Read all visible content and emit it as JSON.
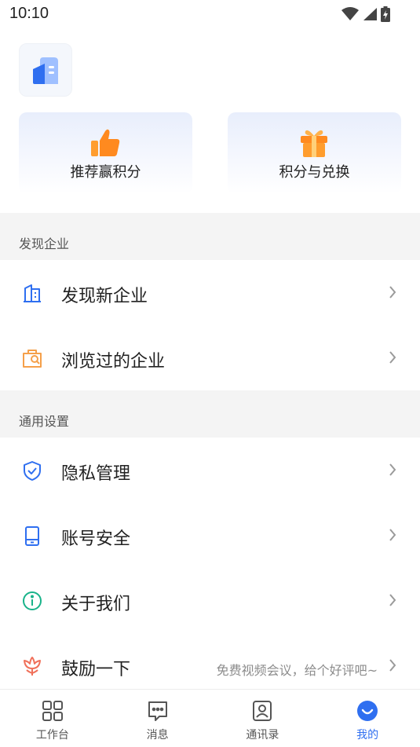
{
  "status_bar": {
    "time": "10:10",
    "icons": [
      "wifi-icon",
      "cellular-icon",
      "battery-charging-icon"
    ]
  },
  "logo": {
    "icon": "building-logo-icon",
    "colors": [
      "#2f6ff0",
      "#9fc0ff"
    ]
  },
  "promo": [
    {
      "label": "推荐赢积分",
      "icon": "thumbs-up-icon",
      "color": "#ff8a1f"
    },
    {
      "label": "积分与兑换",
      "icon": "gift-icon",
      "color": "#ff8a1f"
    }
  ],
  "sections": [
    {
      "title": "发现企业",
      "items": [
        {
          "label": "发现新企业",
          "icon": "building-icon",
          "icon_color": "#2f6ff0"
        },
        {
          "label": "浏览过的企业",
          "icon": "company-search-icon",
          "icon_color": "#f5a04a"
        }
      ]
    },
    {
      "title": "通用设置",
      "items": [
        {
          "label": "隐私管理",
          "icon": "shield-check-icon",
          "icon_color": "#2f6ff0"
        },
        {
          "label": "账号安全",
          "icon": "phone-icon",
          "icon_color": "#2f6ff0"
        },
        {
          "label": "关于我们",
          "icon": "info-icon",
          "icon_color": "#19b38a"
        },
        {
          "label": "鼓励一下",
          "icon": "flower-icon",
          "icon_color": "#f0705a",
          "hint": "免费视频会议，给个好评吧~"
        }
      ]
    }
  ],
  "tabs": [
    {
      "label": "工作台",
      "icon": "grid-icon",
      "active": false
    },
    {
      "label": "消息",
      "icon": "message-icon",
      "active": false
    },
    {
      "label": "通讯录",
      "icon": "contacts-icon",
      "active": false
    },
    {
      "label": "我的",
      "icon": "profile-smile-icon",
      "active": true
    }
  ],
  "colors": {
    "accent": "#2f6ff0",
    "section_bg": "#f4f4f4",
    "chevron": "#9a9a9a"
  }
}
